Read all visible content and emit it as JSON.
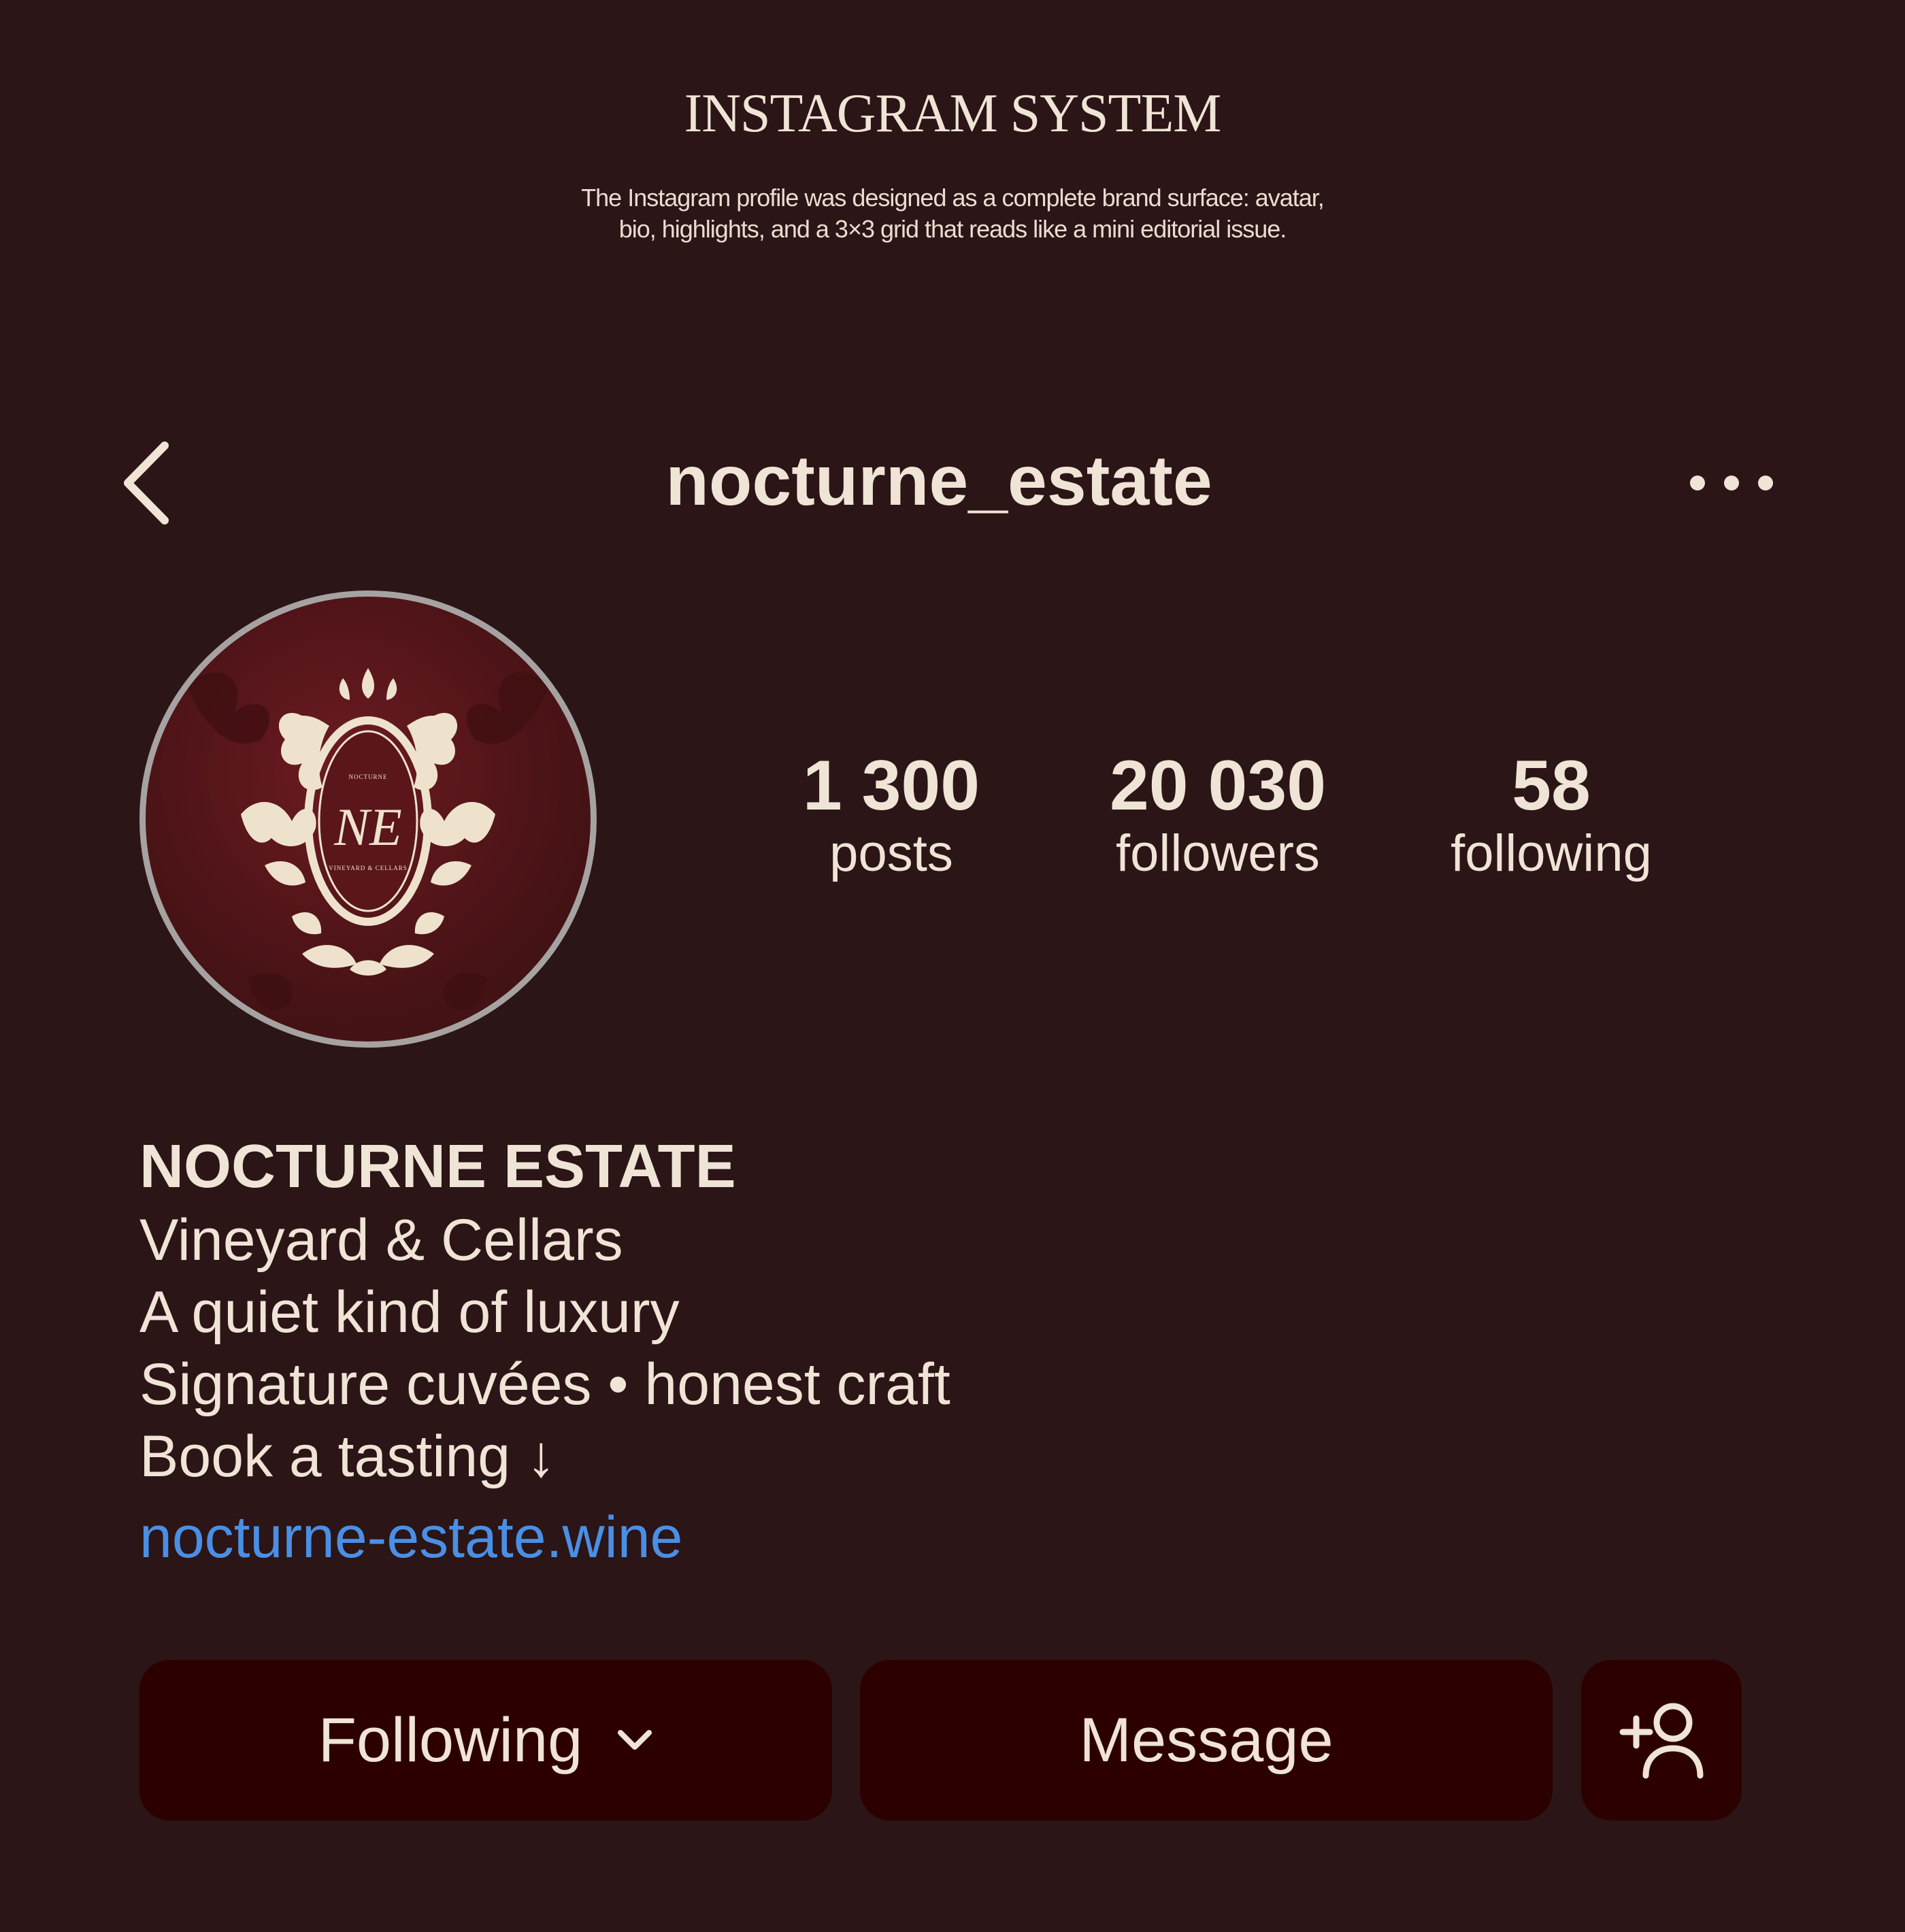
{
  "header": {
    "title": "INSTAGRAM SYSTEM",
    "description_line1": "The Instagram profile was designed as a complete brand surface: avatar,",
    "description_line2": "bio, highlights, and a 3×3 grid that reads like a mini editorial issue."
  },
  "nav": {
    "back_icon": "chevron-left-icon",
    "username": "nocturne_estate",
    "more_icon": "more-horizontal-icon"
  },
  "avatar": {
    "monogram": "NE",
    "top_text": "NOCTURNE",
    "bottom_text": "VINEYARD & CELLARS"
  },
  "stats": [
    {
      "value": "1 300",
      "label": "posts"
    },
    {
      "value": "20 030",
      "label": "followers"
    },
    {
      "value": "58",
      "label": "following"
    }
  ],
  "bio": {
    "name": "NOCTURNE ESTATE",
    "lines": [
      "Vineyard & Cellars",
      "A quiet kind of luxury",
      "Signature cuvées • honest craft",
      "Book a tasting ↓"
    ],
    "link": "nocturne-estate.wine"
  },
  "buttons": {
    "following": "Following",
    "message": "Message",
    "add_user_icon": "add-user-icon"
  },
  "colors": {
    "background": "#2b1516",
    "text": "#efe4d6",
    "button": "#2d0000",
    "link": "#4a8fe6",
    "avatar_ring": "#a7a2a2"
  }
}
